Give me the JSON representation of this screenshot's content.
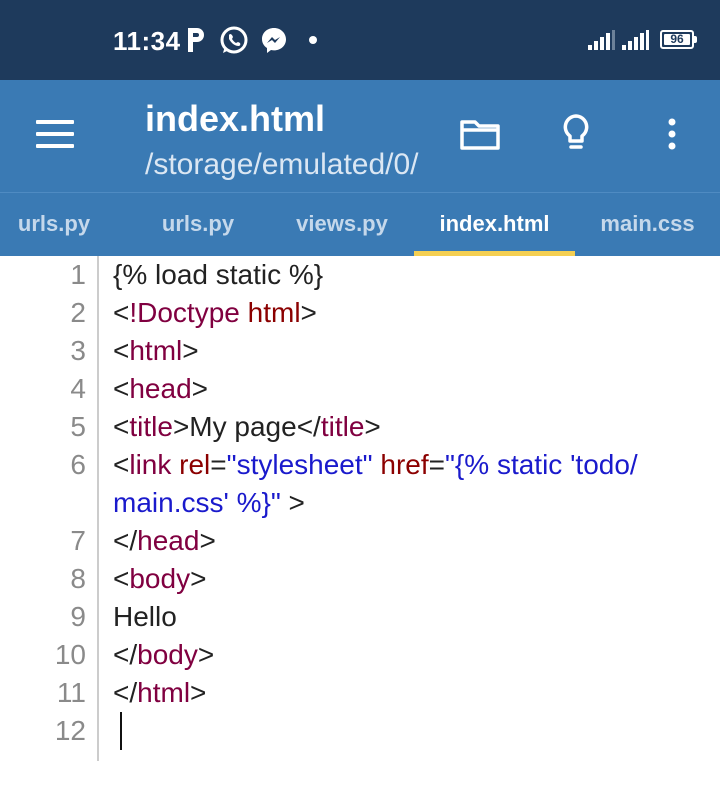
{
  "status_bar": {
    "time": "11:34",
    "notifications": [
      "p-icon",
      "whatsapp-icon",
      "messenger-icon",
      "dot-icon"
    ],
    "battery": "96"
  },
  "app_bar": {
    "title": "index.html",
    "subtitle": "/storage/emulated/0/",
    "actions": [
      "folder-icon",
      "lightbulb-icon",
      "more-vert-icon"
    ]
  },
  "tabs": [
    {
      "label": "urls.py",
      "active": false
    },
    {
      "label": "urls.py",
      "active": false
    },
    {
      "label": "views.py",
      "active": false
    },
    {
      "label": "index.html",
      "active": true
    },
    {
      "label": "main.css",
      "active": false
    }
  ],
  "editor": {
    "line_numbers": [
      "1",
      "2",
      "3",
      "4",
      "5",
      "6",
      "7",
      "8",
      "9",
      "10",
      "11",
      "12"
    ],
    "lines": [
      [
        {
          "t": "{% load static %}",
          "c": "txt"
        }
      ],
      [
        {
          "t": "<",
          "c": "br"
        },
        {
          "t": "!Doctype",
          "c": "tag"
        },
        {
          "t": " ",
          "c": "txt"
        },
        {
          "t": "html",
          "c": "attr"
        },
        {
          "t": ">",
          "c": "br"
        }
      ],
      [
        {
          "t": "<",
          "c": "br"
        },
        {
          "t": "html",
          "c": "tag"
        },
        {
          "t": ">",
          "c": "br"
        }
      ],
      [
        {
          "t": "<",
          "c": "br"
        },
        {
          "t": "head",
          "c": "tag"
        },
        {
          "t": ">",
          "c": "br"
        }
      ],
      [
        {
          "t": "<",
          "c": "br"
        },
        {
          "t": "title",
          "c": "tag"
        },
        {
          "t": ">",
          "c": "br"
        },
        {
          "t": "My page",
          "c": "txt"
        },
        {
          "t": "</",
          "c": "br"
        },
        {
          "t": "title",
          "c": "tag"
        },
        {
          "t": ">",
          "c": "br"
        }
      ],
      [
        {
          "t": "<",
          "c": "br"
        },
        {
          "t": "link",
          "c": "tag"
        },
        {
          "t": " ",
          "c": "txt"
        },
        {
          "t": "rel",
          "c": "attr"
        },
        {
          "t": "=",
          "c": "br"
        },
        {
          "t": "\"stylesheet\"",
          "c": "str"
        },
        {
          "t": " ",
          "c": "txt"
        },
        {
          "t": "href",
          "c": "attr"
        },
        {
          "t": "=",
          "c": "br"
        },
        {
          "t": "\"{% static 'todo/",
          "c": "str"
        }
      ],
      [
        {
          "t": "main.css' %}\"",
          "c": "str"
        },
        {
          "t": " >",
          "c": "br"
        }
      ],
      [
        {
          "t": "</",
          "c": "br"
        },
        {
          "t": "head",
          "c": "tag"
        },
        {
          "t": ">",
          "c": "br"
        }
      ],
      [
        {
          "t": "<",
          "c": "br"
        },
        {
          "t": "body",
          "c": "tag"
        },
        {
          "t": ">",
          "c": "br"
        }
      ],
      [
        {
          "t": "Hello",
          "c": "txt"
        }
      ],
      [
        {
          "t": "</",
          "c": "br"
        },
        {
          "t": "body",
          "c": "tag"
        },
        {
          "t": ">",
          "c": "br"
        }
      ],
      [
        {
          "t": "</",
          "c": "br"
        },
        {
          "t": "html",
          "c": "tag"
        },
        {
          "t": ">",
          "c": "br"
        }
      ],
      []
    ],
    "line_number_rows": [
      0,
      1,
      2,
      3,
      4,
      5,
      7,
      8,
      9,
      10,
      11,
      12
    ]
  }
}
